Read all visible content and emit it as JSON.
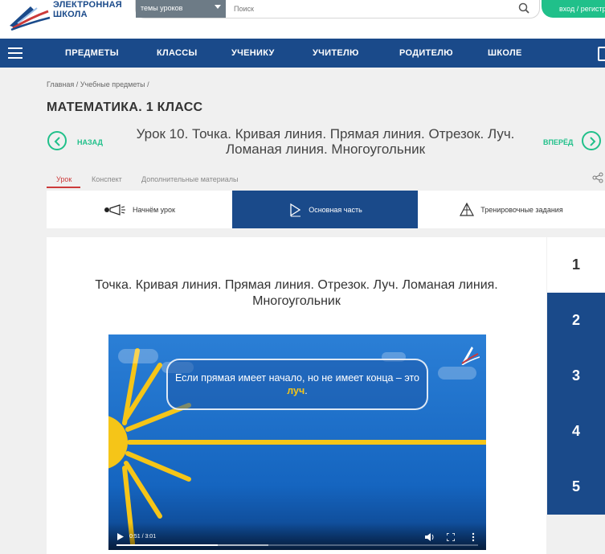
{
  "header": {
    "logo_text": "ЭЛЕКТРОННАЯ\nШКОЛА",
    "topic_select": "темы уроков",
    "search_placeholder": "Поиск",
    "login_label": "вход / регистр"
  },
  "nav": {
    "items": [
      "ПРЕДМЕТЫ",
      "КЛАССЫ",
      "УЧЕНИКУ",
      "УЧИТЕЛЮ",
      "РОДИТЕЛЮ",
      "ШКОЛЕ"
    ]
  },
  "breadcrumb": {
    "home": "Главная",
    "subjects": "Учебные предметы",
    "sep": "/"
  },
  "page_title": "МАТЕМАТИКА. 1 КЛАСС",
  "lesson": {
    "prev_label": "НАЗАД",
    "next_label": "ВПЕРЁД",
    "title": "Урок 10. Точка. Кривая линия. Прямая линия. Отрезок. Луч. Ломаная линия. Многоугольник"
  },
  "tabs": [
    "Урок",
    "Конспект",
    "Дополнительные материалы"
  ],
  "sections": [
    "Начнём урок",
    "Основная часть",
    "Тренировочные задания"
  ],
  "content": {
    "title": "Точка. Кривая линия. Прямая линия. Отрезок. Луч. Ломаная линия. Многоугольник",
    "video": {
      "text_before": "Если прямая имеет начало, но не имеет конца – это ",
      "highlight": "луч",
      "text_after": ".",
      "time": "0:51 / 3:01",
      "progress": 0.28,
      "buffered": 0.42
    }
  },
  "steps": [
    "1",
    "2",
    "3",
    "4",
    "5"
  ],
  "colors": {
    "brand_blue": "#1a4a8a",
    "accent_green": "#20c08a",
    "active_tab": "#cc3a3a",
    "highlight_yellow": "#f5c518"
  }
}
